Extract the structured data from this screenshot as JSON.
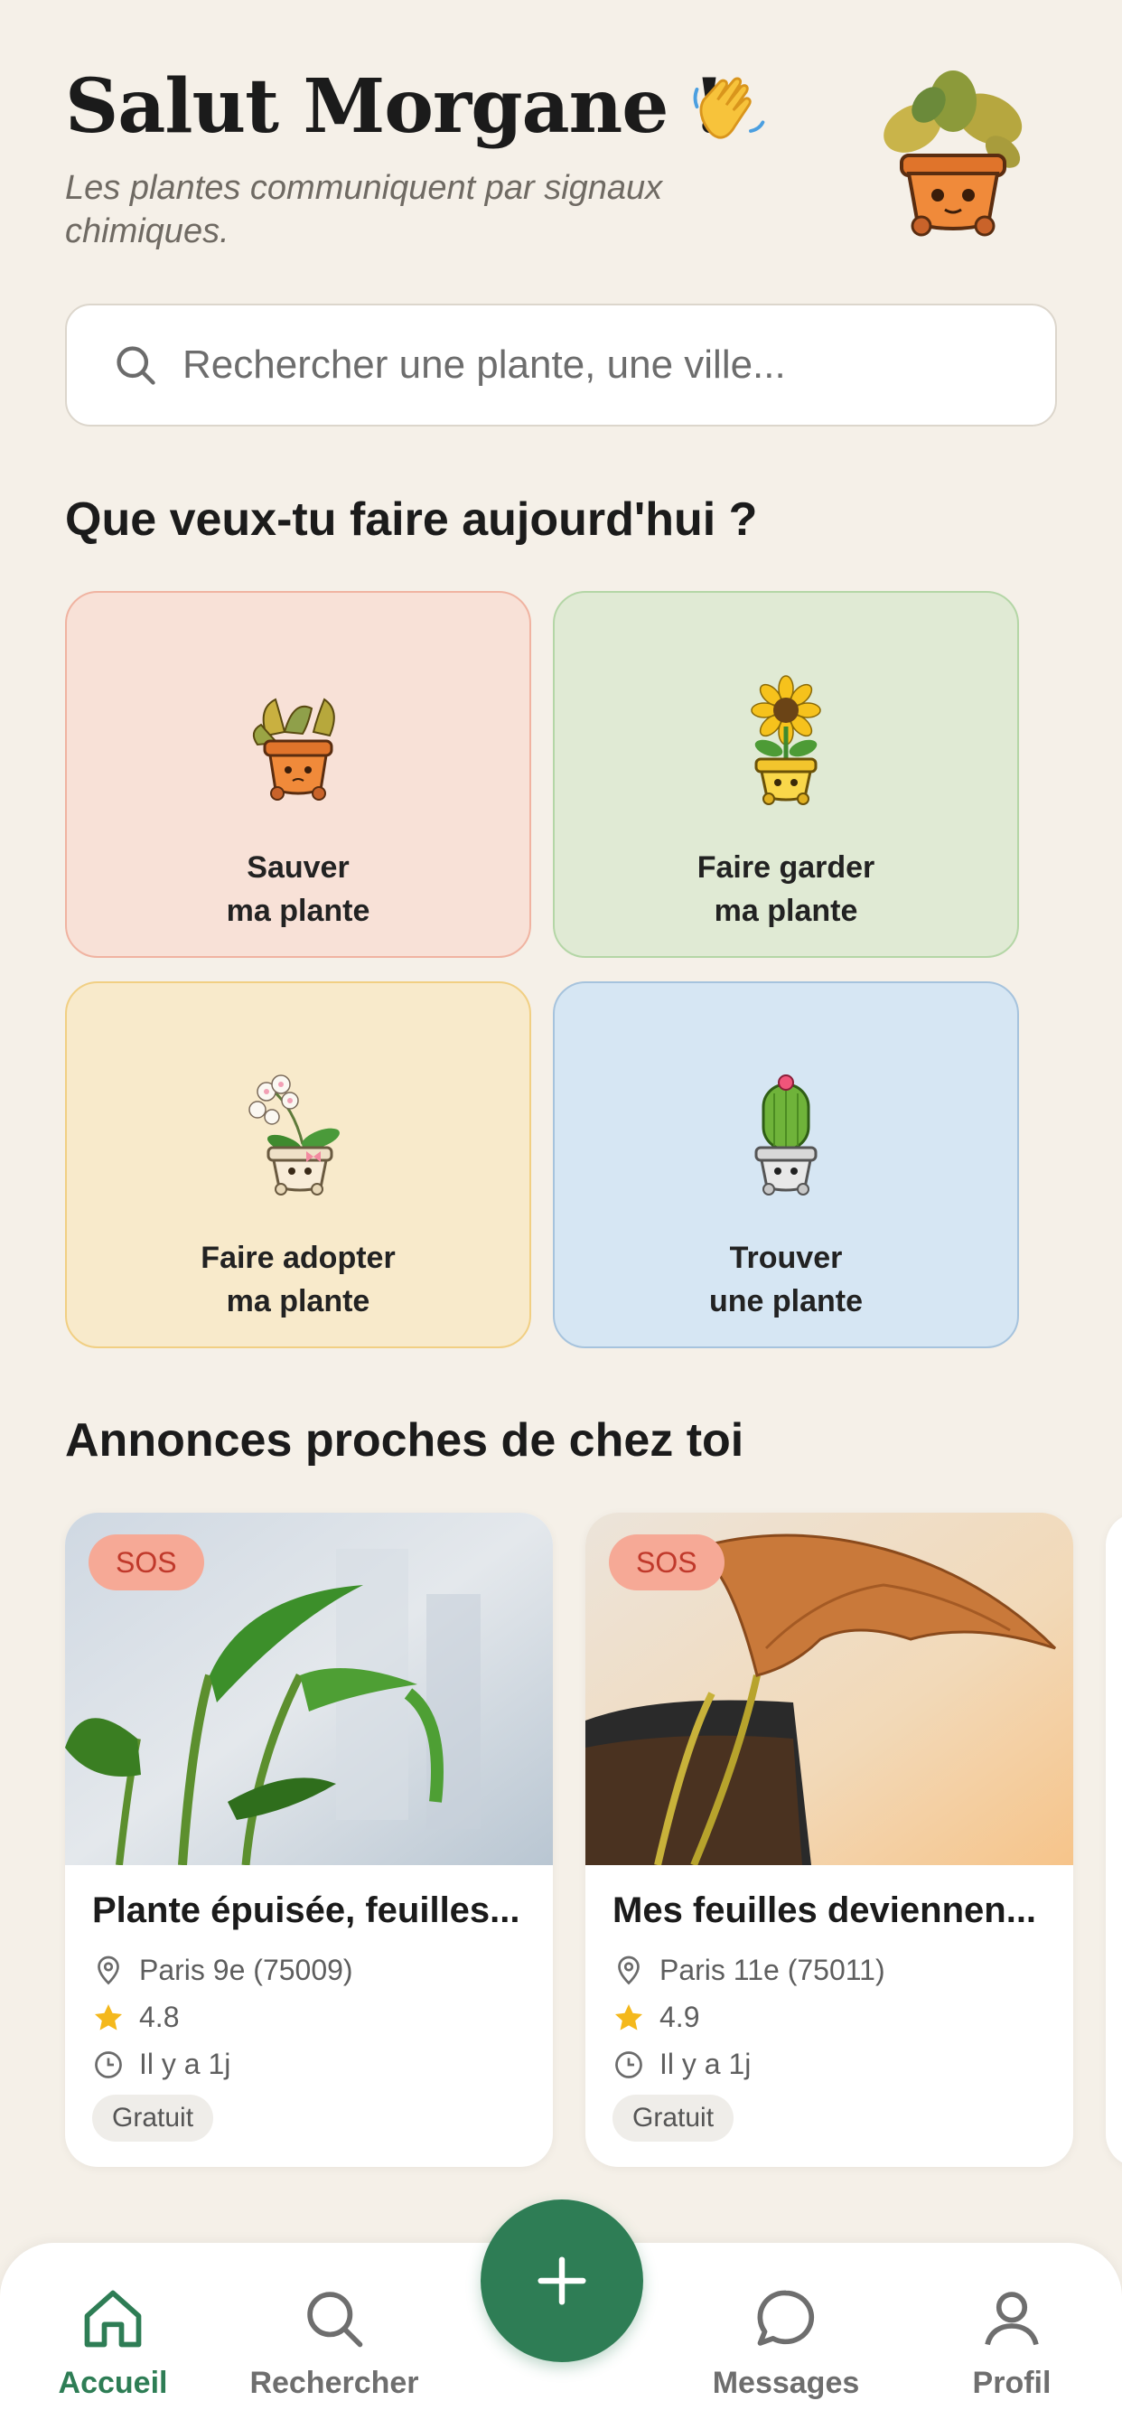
{
  "header": {
    "greeting": "Salut Morgane !",
    "subtitle": "Les plantes communiquent par signaux chimiques."
  },
  "search": {
    "placeholder": "Rechercher une plante, une ville..."
  },
  "actions_section": {
    "title": "Que veux-tu faire aujourd'hui ?",
    "cards": [
      {
        "label": "Sauver\nma plante",
        "icon": "wilted-plant-icon",
        "color": "#f8e1d7"
      },
      {
        "label": "Faire garder\nma plante",
        "icon": "sunflower-icon",
        "color": "#e0ead4"
      },
      {
        "label": "Faire adopter\nma plante",
        "icon": "orchid-icon",
        "color": "#f8eacb"
      },
      {
        "label": "Trouver\nune plante",
        "icon": "cactus-icon",
        "color": "#d6e6f3"
      }
    ]
  },
  "listings_section": {
    "title": "Annonces proches de chez toi",
    "items": [
      {
        "tag": "SOS",
        "title": "Plante épuisée, feuilles...",
        "location": "Paris 9e (75009)",
        "rating": "4.8",
        "time": "Il y a 1j",
        "price": "Gratuit"
      },
      {
        "tag": "SOS",
        "title": "Mes feuilles deviennen...",
        "location": "Paris 11e (75011)",
        "rating": "4.9",
        "time": "Il y a 1j",
        "price": "Gratuit"
      }
    ]
  },
  "nav": {
    "items": [
      {
        "label": "Accueil",
        "icon": "home-icon",
        "active": true
      },
      {
        "label": "Rechercher",
        "icon": "search-icon"
      },
      {
        "label": "Messages",
        "icon": "chat-icon"
      },
      {
        "label": "Profil",
        "icon": "user-icon"
      }
    ],
    "fab_icon": "plus-icon"
  },
  "colors": {
    "background": "#f5f0e8",
    "accent": "#2e7d55",
    "sos_badge": "#f6a996"
  }
}
